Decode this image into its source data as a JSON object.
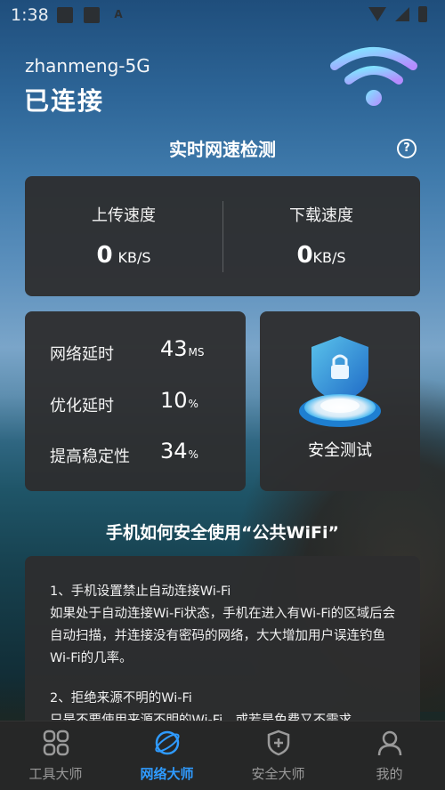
{
  "status_bar": {
    "time": "1:38"
  },
  "wifi": {
    "ssid": "zhanmeng-5G",
    "status": "已连接"
  },
  "speed_test": {
    "title": "实时网速检测",
    "help": "?",
    "upload": {
      "label": "上传速度",
      "value": "0",
      "unit": "KB/S"
    },
    "download": {
      "label": "下载速度",
      "value": "0",
      "unit": "KB/S"
    }
  },
  "latency": {
    "rows": [
      {
        "label": "网络延时",
        "value": "43",
        "unit": "MS"
      },
      {
        "label": "优化延时",
        "value": "10",
        "unit": "%"
      },
      {
        "label": "提高稳定性",
        "value": "34",
        "unit": "%"
      }
    ]
  },
  "security": {
    "label": "安全测试"
  },
  "tips": {
    "title": "手机如何安全使用“公共WiFi”",
    "items": [
      "1、手机设置禁止自动连接Wi-Fi",
      "如果处于自动连接Wi-Fi状态，手机在进入有Wi-Fi的区域后会自动扫描，并连接没有密码的网络，大大增加用户误连钓鱼Wi-Fi的几率。",
      "2、拒绝来源不明的Wi-Fi",
      "只是不要使用来源不明的Wi-Fi，或若是免费又不需求"
    ]
  },
  "bottom_nav": [
    {
      "label": "工具大师",
      "icon": "tools-grid-icon",
      "active": false
    },
    {
      "label": "网络大师",
      "icon": "network-globe-icon",
      "active": true
    },
    {
      "label": "安全大师",
      "icon": "shield-plus-icon",
      "active": false
    },
    {
      "label": "我的",
      "icon": "user-icon",
      "active": false
    }
  ],
  "colors": {
    "active": "#2f9bff",
    "inactive": "#9a9a9a",
    "card": "#2d2d2e"
  }
}
